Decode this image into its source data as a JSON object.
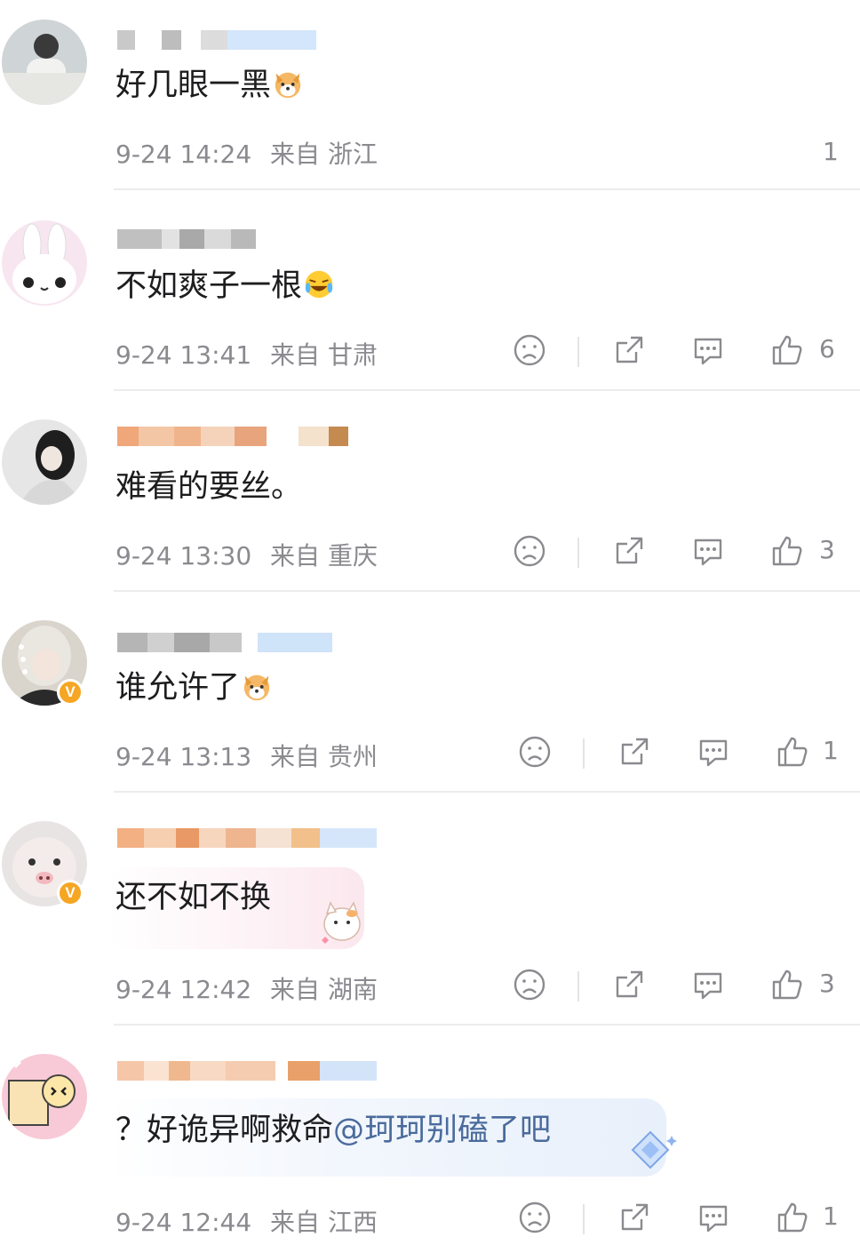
{
  "comments": [
    {
      "text": "好几眼一黑",
      "time": "9-24 14:24",
      "from": "来自",
      "location": "浙江",
      "likes": "1",
      "emoji": "dog-emoji"
    },
    {
      "text": "不如爽子一根",
      "time": "9-24 13:41",
      "from": "来自",
      "location": "甘肃",
      "likes": "6",
      "emoji": "laugh-cry-emoji"
    },
    {
      "text": "难看的要丝。",
      "time": "9-24 13:30",
      "from": "来自",
      "location": "重庆",
      "likes": "3"
    },
    {
      "text": "谁允许了",
      "time": "9-24 13:13",
      "from": "来自",
      "location": "贵州",
      "likes": "1",
      "emoji": "dog-emoji",
      "verified": "V"
    },
    {
      "text": "还不如不换",
      "time": "9-24 12:42",
      "from": "来自",
      "location": "湖南",
      "likes": "3",
      "verified": "V"
    },
    {
      "text_prefix": "？好诡异啊救命",
      "mention": "@珂珂别磕了吧",
      "time": "9-24 12:44",
      "from": "来自",
      "location": "江西",
      "likes": "1"
    }
  ],
  "icons": [
    "dislike-icon",
    "share-icon",
    "reply-icon",
    "like-icon"
  ],
  "colors": {
    "meta": "#8a8a8f",
    "mention": "#4a6b9c",
    "badge": "#f5a623",
    "divider": "#ececec"
  }
}
